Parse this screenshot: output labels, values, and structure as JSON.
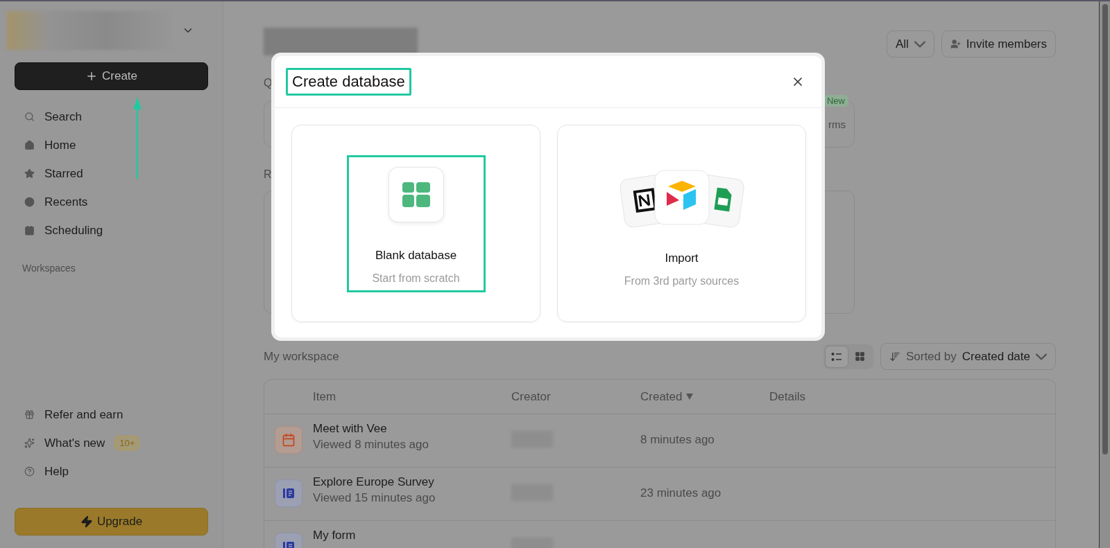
{
  "sidebar": {
    "create_button": {
      "label": "Create",
      "annotated": true
    },
    "nav": [
      {
        "label": "Search"
      },
      {
        "label": "Home"
      },
      {
        "label": "Starred"
      },
      {
        "label": "Recents"
      },
      {
        "label": "Scheduling"
      }
    ],
    "section_label": "Workspaces",
    "footer": [
      {
        "label": "Refer and earn"
      },
      {
        "label": "What's new",
        "badge": "10+"
      },
      {
        "label": "Help"
      }
    ],
    "upgrade_button": "Upgrade"
  },
  "header": {
    "filter": "All",
    "invite_button": "Invite members"
  },
  "quick_section": {
    "label": "Q",
    "card_text": "rms",
    "badge": "New"
  },
  "recent_section": {
    "label": "R"
  },
  "modal": {
    "title": "Create database",
    "title_highlighted": true,
    "options": [
      {
        "kind": "blank",
        "title": "Blank database",
        "subtitle": "Start from scratch",
        "highlighted": true
      },
      {
        "kind": "import",
        "title": "Import",
        "subtitle": "From 3rd party sources",
        "highlighted": false
      }
    ]
  },
  "workspace": {
    "title": "My workspace",
    "views": [
      {
        "kind": "list",
        "selected": true
      },
      {
        "kind": "grid",
        "selected": false
      }
    ],
    "sort": {
      "prefix": "Sorted by",
      "value": "Created date"
    },
    "columns": [
      {
        "label": "Item",
        "sorted": false
      },
      {
        "label": "Creator",
        "sorted": false
      },
      {
        "label": "Created",
        "sorted": true
      },
      {
        "label": "Details",
        "sorted": false
      }
    ],
    "rows": [
      {
        "kind": "calendar",
        "name": "Meet with Vee",
        "viewed": "Viewed 8 minutes ago",
        "created": "8 minutes ago"
      },
      {
        "kind": "form",
        "name": "Explore Europe Survey",
        "viewed": "Viewed 15 minutes ago",
        "created": "23 minutes ago"
      },
      {
        "kind": "form",
        "name": "My form"
      }
    ]
  }
}
